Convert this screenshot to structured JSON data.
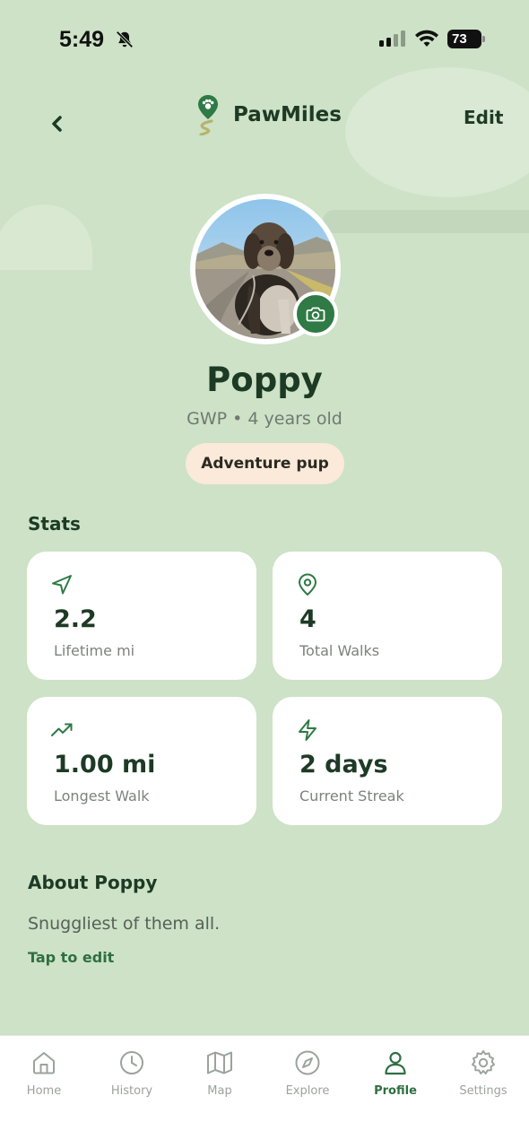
{
  "status_bar": {
    "time": "5:49",
    "battery": "73"
  },
  "header": {
    "brand": "PawMiles",
    "edit_label": "Edit"
  },
  "profile": {
    "name": "Poppy",
    "subtitle": "GWP • 4 years old",
    "badge": "Adventure pup"
  },
  "stats": {
    "title": "Stats",
    "cards": [
      {
        "icon": "navigation-arrow-icon",
        "value": "2.2",
        "label": "Lifetime mi"
      },
      {
        "icon": "map-pin-icon",
        "value": "4",
        "label": "Total Walks"
      },
      {
        "icon": "trending-up-icon",
        "value": "1.00 mi",
        "label": "Longest Walk"
      },
      {
        "icon": "lightning-bolt-icon",
        "value": "2 days",
        "label": "Current Streak"
      }
    ]
  },
  "about": {
    "title": "About Poppy",
    "text": "Snuggliest of them all.",
    "tap_to_edit": "Tap to edit"
  },
  "tabs": [
    {
      "label": "Home",
      "icon": "home-icon",
      "active": false
    },
    {
      "label": "History",
      "icon": "clock-icon",
      "active": false
    },
    {
      "label": "Map",
      "icon": "map-icon",
      "active": false
    },
    {
      "label": "Explore",
      "icon": "compass-icon",
      "active": false
    },
    {
      "label": "Profile",
      "icon": "user-icon",
      "active": true
    },
    {
      "label": "Settings",
      "icon": "gear-icon",
      "active": false
    }
  ],
  "colors": {
    "background": "#cde2c6",
    "accent": "#2f7a45",
    "badge_bg": "#fbe9d9",
    "text_dark": "#1d3a25",
    "tab_active": "#2f6f42",
    "tab_inactive": "#9ba39c"
  }
}
